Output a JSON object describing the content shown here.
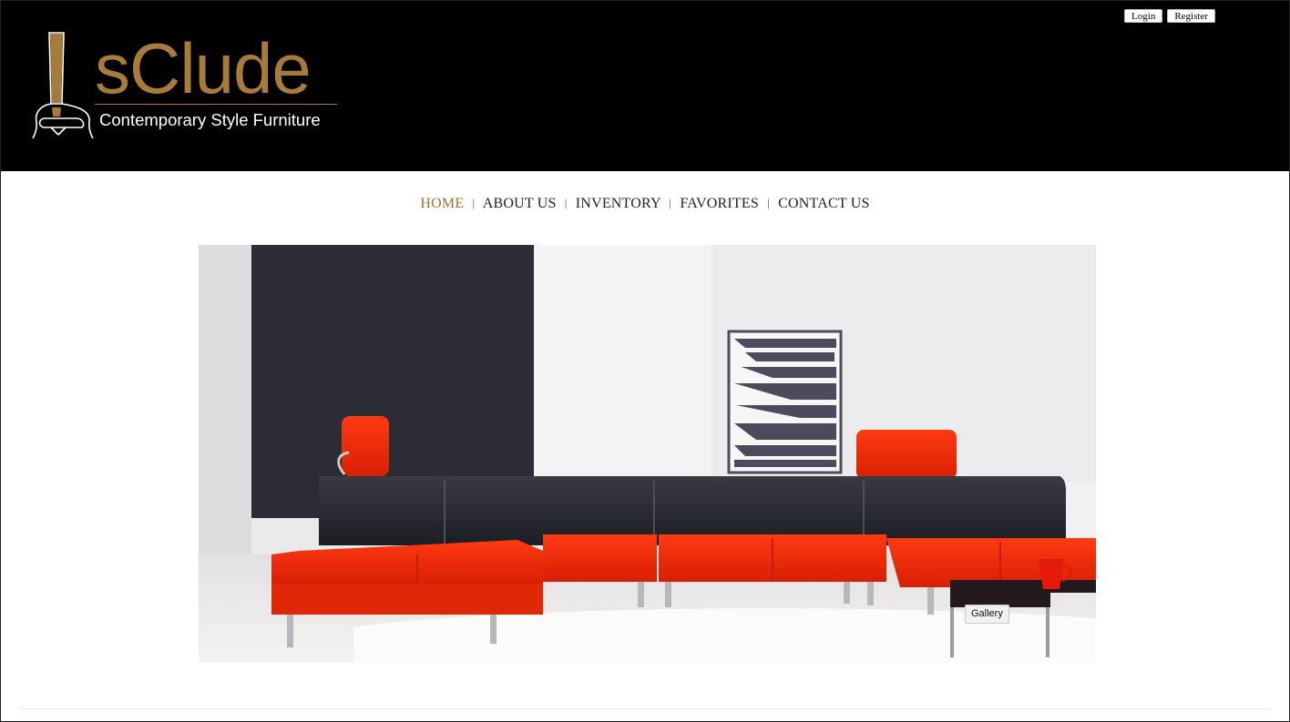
{
  "brand": {
    "name": "sClude",
    "tagline": "Contemporary Style Furniture",
    "color": "#a77b3a"
  },
  "auth": {
    "login_label": "Login",
    "register_label": "Register"
  },
  "nav": {
    "active_color": "#9c7432",
    "items": [
      {
        "label": "HOME",
        "active": true
      },
      {
        "label": "ABOUT US",
        "active": false
      },
      {
        "label": "INVENTORY",
        "active": false
      },
      {
        "label": "FAVORITES",
        "active": false
      },
      {
        "label": "CONTACT US",
        "active": false
      }
    ],
    "separator": "|"
  },
  "hero": {
    "button_label": "Gallery"
  }
}
